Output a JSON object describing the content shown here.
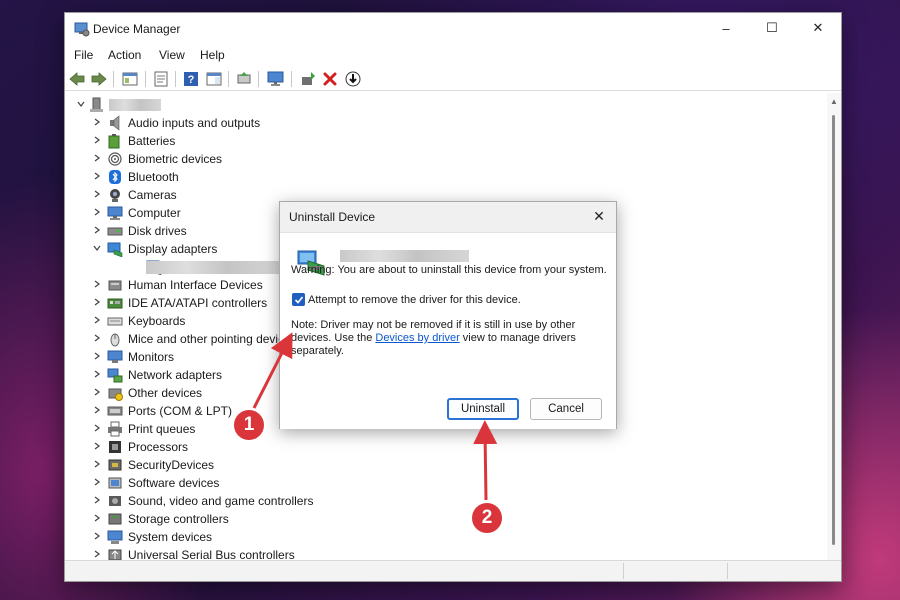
{
  "window": {
    "title": "Device Manager",
    "controls": {
      "minimize": "–",
      "maximize": "☐",
      "close": "✕"
    }
  },
  "menu": [
    "File",
    "Action",
    "View",
    "Help"
  ],
  "tree": {
    "items": [
      {
        "label": "Audio inputs and outputs",
        "icon": "speaker-icon"
      },
      {
        "label": "Batteries",
        "icon": "battery-icon"
      },
      {
        "label": "Biometric devices",
        "icon": "fingerprint-icon"
      },
      {
        "label": "Bluetooth",
        "icon": "bluetooth-icon"
      },
      {
        "label": "Cameras",
        "icon": "camera-icon"
      },
      {
        "label": "Computer",
        "icon": "computer-icon"
      },
      {
        "label": "Disk drives",
        "icon": "disk-icon"
      },
      {
        "label": "Display adapters",
        "icon": "display-adapter-icon",
        "expanded": true
      },
      {
        "label": "",
        "icon": "display-adapter-icon",
        "child": true
      },
      {
        "label": "Human Interface Devices",
        "icon": "hid-icon"
      },
      {
        "label": "IDE ATA/ATAPI controllers",
        "icon": "ide-icon"
      },
      {
        "label": "Keyboards",
        "icon": "keyboard-icon"
      },
      {
        "label": "Mice and other pointing devices",
        "icon": "mouse-icon"
      },
      {
        "label": "Monitors",
        "icon": "monitor-icon"
      },
      {
        "label": "Network adapters",
        "icon": "network-icon"
      },
      {
        "label": "Other devices",
        "icon": "unknown-device-icon"
      },
      {
        "label": "Ports (COM & LPT)",
        "icon": "port-icon"
      },
      {
        "label": "Print queues",
        "icon": "printer-icon"
      },
      {
        "label": "Processors",
        "icon": "processor-icon"
      },
      {
        "label": "SecurityDevices",
        "icon": "security-icon"
      },
      {
        "label": "Software devices",
        "icon": "software-icon"
      },
      {
        "label": "Sound, video and game controllers",
        "icon": "sound-icon"
      },
      {
        "label": "Storage controllers",
        "icon": "storage-icon"
      },
      {
        "label": "System devices",
        "icon": "system-icon"
      },
      {
        "label": "Universal Serial Bus controllers",
        "icon": "usb-icon"
      }
    ]
  },
  "dialog": {
    "title": "Uninstall Device",
    "close": "✕",
    "warning": "Warning: You are about to uninstall this device from your system.",
    "checkbox_label": "Attempt to remove the driver for this device.",
    "checkbox_checked": true,
    "note_before": "Note: Driver may not be removed if it is still in use by other devices. Use the ",
    "note_link": "Devices by driver",
    "note_after": " view to manage drivers separately.",
    "uninstall_label": "Uninstall",
    "cancel_label": "Cancel"
  },
  "callouts": {
    "one": "1",
    "two": "2"
  },
  "colors": {
    "accent": "#2a72d4",
    "callout": "#d9353a",
    "link": "#0b57d0"
  }
}
